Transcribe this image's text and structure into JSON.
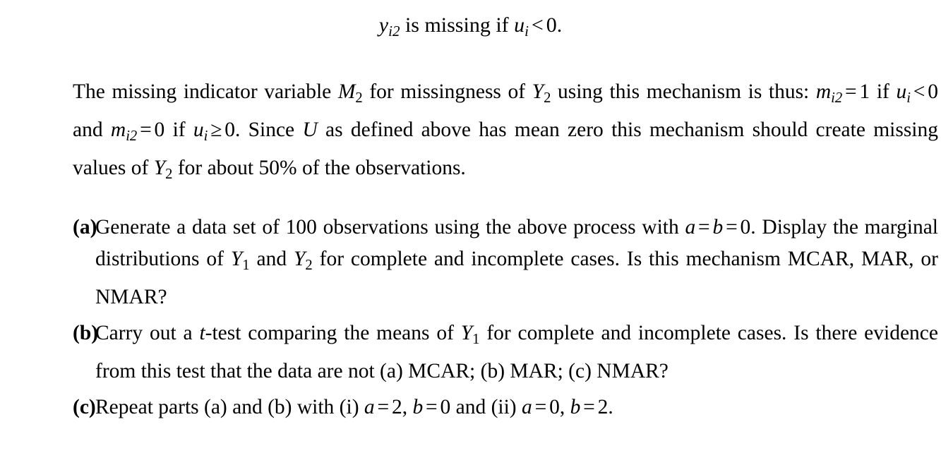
{
  "document": {
    "type": "textbook-exercise-excerpt",
    "background_color": "#ffffff",
    "text_color": "#000000"
  },
  "display_equation": {
    "var_y": "y",
    "sub_y": "i2",
    "text_middle": " is missing if ",
    "var_u": "u",
    "sub_u": "i",
    "relation": "<",
    "value": "0",
    "period": ".",
    "plain": "y_i2 is missing if u_i < 0."
  },
  "paragraph": {
    "s1": "The missing indicator variable ",
    "var_M": "M",
    "sub_M": "2",
    "s2": " for missingness of ",
    "var_Y": "Y",
    "sub_Y": "2",
    "s3": " using this mechanism is thus: ",
    "var_m1": "m",
    "sub_m1": "i2",
    "eq1": "=",
    "val1": "1",
    "s4": " if ",
    "var_u1": "u",
    "sub_u1": "i",
    "rel1": "<",
    "val2": "0",
    "s5": " and ",
    "var_m2": "m",
    "sub_m2": "i2",
    "eq2": "=",
    "val3": "0",
    "s6": " if ",
    "var_u2": "u",
    "sub_u2": "i",
    "rel2": "≥",
    "val4": "0",
    "s7": ". Since ",
    "var_U": "U",
    "s8": " as defined above has mean zero this mechanism should create missing values of ",
    "var_Y2": "Y",
    "sub_Y2": "2",
    "s9": " for about 50% of the observations.",
    "plain": "The missing indicator variable M2 for missingness of Y2 using this mechanism is thus: mi2 = 1 if ui < 0 and mi2 = 0 if ui >= 0. Since U as defined above has mean zero this mechanism should create missing values of Y2 for about 50% of the observations."
  },
  "list": {
    "items": [
      {
        "marker": "(a)",
        "s1": "Generate a data set of 100 observations using the above process with ",
        "var_a": "a",
        "eq1": "=",
        "var_b": "b",
        "eq2": "=",
        "val": "0",
        "s2": ". Display the marginal distributions of ",
        "var_Y1": "Y",
        "sub_Y1": "1",
        "s3": " and ",
        "var_Y2": "Y",
        "sub_Y2": "2",
        "s4": " for complete and incomplete cases. Is this mechanism MCAR, MAR, or NMAR?",
        "plain": "(a) Generate a data set of 100 observations using the above process with a = b = 0. Display the marginal distributions of Y1 and Y2 for complete and incomplete cases. Is this mechanism MCAR, MAR, or NMAR?"
      },
      {
        "marker": "(b)",
        "s1": "Carry out a ",
        "var_t": "t",
        "s2": "-test comparing the means of ",
        "var_Y1": "Y",
        "sub_Y1": "1",
        "s3": " for complete and incomplete cases. Is there evidence from this test that the data are not (a) MCAR; (b) MAR; (c) NMAR?",
        "plain": "(b) Carry out a t-test comparing the means of Y1 for complete and incomplete cases. Is there evidence from this test that the data are not (a) MCAR; (b) MAR; (c) NMAR?"
      },
      {
        "marker": "(c)",
        "s1": "Repeat parts (a) and (b) with (i) ",
        "var_a1": "a",
        "eq1": "=",
        "val1": "2",
        "comma1": ", ",
        "var_b1": "b",
        "eq2": "=",
        "val2": "0",
        "s2": " and (ii) ",
        "var_a2": "a",
        "eq3": "=",
        "val3": "0",
        "comma2": ", ",
        "var_b2": "b",
        "eq4": "=",
        "val4": "2",
        "period": ".",
        "plain": "(c) Repeat parts (a) and (b) with (i) a = 2, b = 0 and (ii) a = 0, b = 2."
      }
    ]
  }
}
